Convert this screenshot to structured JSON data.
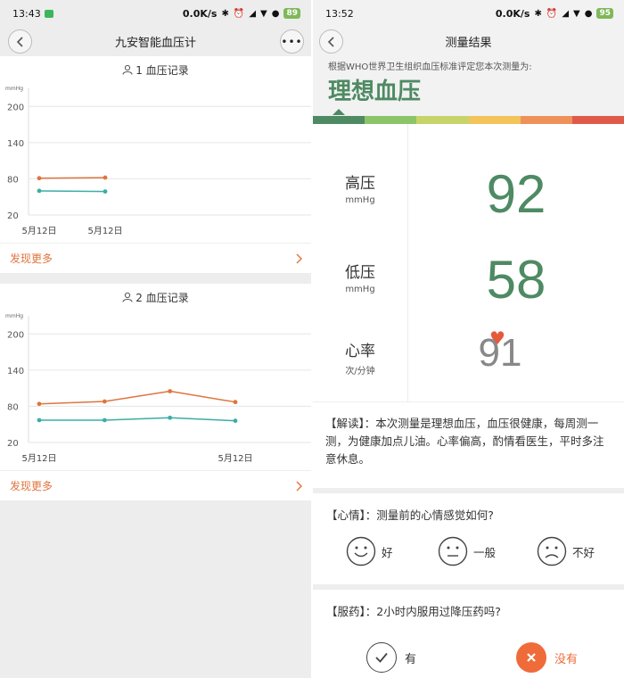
{
  "left": {
    "status": {
      "time": "13:43",
      "speed": "0.0K/s",
      "battery": "89"
    },
    "nav": {
      "title": "九安智能血压计"
    },
    "cards": [
      {
        "title": "1 血压记录",
        "more": "发现更多",
        "chart_data": {
          "type": "line",
          "yunit": "mmHg",
          "yticks": [
            20,
            80,
            140,
            200
          ],
          "ylim": [
            20,
            230
          ],
          "xticks": [
            "5月12日",
            "5月12日"
          ],
          "series": [
            {
              "values": [
                81,
                82
              ],
              "color": "#e0743c"
            },
            {
              "values": [
                60,
                59
              ],
              "color": "#3aada6"
            }
          ]
        }
      },
      {
        "title": "2 血压记录",
        "more": "发现更多",
        "chart_data": {
          "type": "line",
          "yunit": "mmHg",
          "yticks": [
            20,
            80,
            140,
            200
          ],
          "ylim": [
            20,
            230
          ],
          "xticks": [
            "5月12日",
            "5月12日"
          ],
          "series": [
            {
              "values": [
                84,
                88,
                105,
                87
              ],
              "color": "#e0743c"
            },
            {
              "values": [
                57,
                57,
                61,
                56
              ],
              "color": "#3aada6"
            }
          ]
        }
      }
    ]
  },
  "right": {
    "status": {
      "time": "13:52",
      "speed": "0.0K/s",
      "battery": "95"
    },
    "nav": {
      "title": "测量结果"
    },
    "standard_text": "根据WHO世界卫生组织血压标准评定您本次测量为:",
    "result": "理想血压",
    "scale_colors": [
      "#4e8a63",
      "#8cc46a",
      "#c7d46a",
      "#f2c45a",
      "#ef915a",
      "#e05a4a"
    ],
    "measurements": {
      "systolic": {
        "label": "高压",
        "unit": "mmHg",
        "value": "92"
      },
      "diastolic": {
        "label": "低压",
        "unit": "mmHg",
        "value": "58"
      },
      "heart_rate": {
        "label": "心率",
        "unit": "次/分钟",
        "value": "91"
      }
    },
    "interpretation": "【解读】：本次测量是理想血压，血压很健康，每周测一测，为健康加点儿油。心率偏高，酌情看医生，平时多注意休息。",
    "mood": {
      "question": "【心情】：测量前的心情感觉如何?",
      "options": [
        "好",
        "一般",
        "不好"
      ]
    },
    "medication": {
      "question": "【服药】：2小时内服用过降压药吗?",
      "yes": "有",
      "no": "没有"
    }
  }
}
